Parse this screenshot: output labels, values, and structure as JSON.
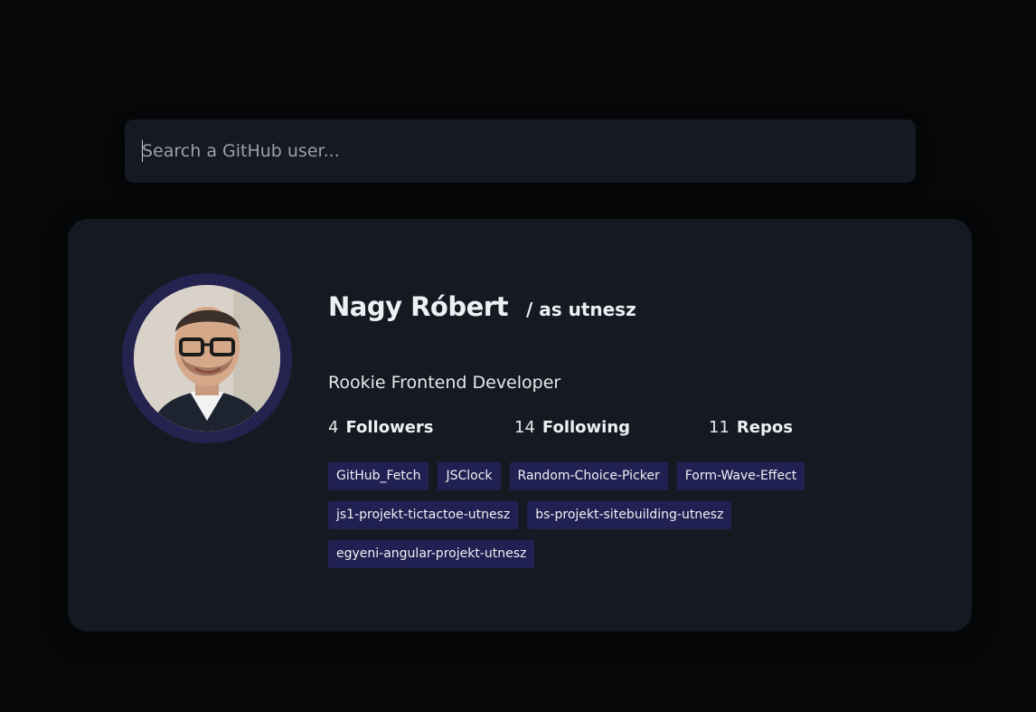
{
  "search": {
    "placeholder": "Search a GitHub user..."
  },
  "profile": {
    "name": "Nagy Róbert",
    "login_label": "/ as utnesz",
    "bio": "Rookie Frontend Developer",
    "avatar_icon": "user-avatar-photo"
  },
  "stats": {
    "followers": {
      "value": "4",
      "label": "Followers"
    },
    "following": {
      "value": "14",
      "label": "Following"
    },
    "repos": {
      "value": "11",
      "label": "Repos"
    }
  },
  "repos": [
    "GitHub_Fetch",
    "JSClock",
    "Random-Choice-Picker",
    "Form-Wave-Effect",
    "js1-projekt-tictactoe-utnesz",
    "bs-projekt-sitebuilding-utnesz",
    "egyeni-angular-projekt-utnesz"
  ],
  "colors": {
    "background": "#050709",
    "card": "#151a22",
    "accent": "#212052",
    "text": "#eef0f3"
  }
}
